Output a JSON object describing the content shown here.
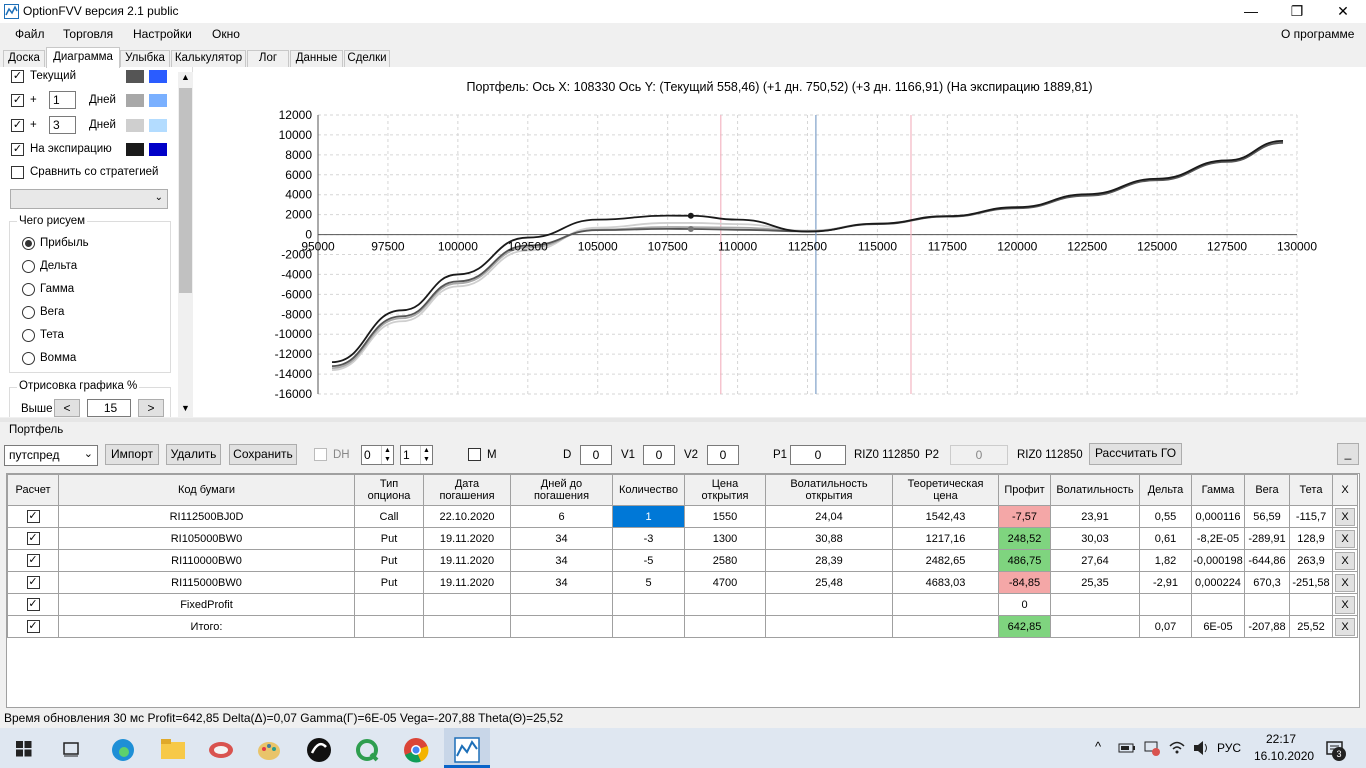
{
  "app": {
    "title": "OptionFVV версия 2.1 public"
  },
  "menu": {
    "items": [
      "Файл",
      "Торговля",
      "Настройки",
      "Окно"
    ],
    "about": "О программе"
  },
  "tabs": [
    {
      "label": "Доска"
    },
    {
      "label": "Диаграмма"
    },
    {
      "label": "Улыбка"
    },
    {
      "label": "Калькулятор"
    },
    {
      "label": "Лог"
    },
    {
      "label": "Данные"
    },
    {
      "label": "Сделки"
    }
  ],
  "left_panel": {
    "current_label": "Текущий",
    "plus_label": "+",
    "days_label": "Дней",
    "days1": "1",
    "days2": "3",
    "expiry_label": "На экспирацию",
    "compare_label": "Сравнить со стратегией",
    "what_title": "Чего рисуем",
    "radios": [
      "Прибыль",
      "Дельта",
      "Гамма",
      "Вега",
      "Тета",
      "Вомма"
    ],
    "draw_title": "Отрисовка графика %",
    "above_label": "Выше",
    "above_value": "15",
    "prev_btn": "<",
    "next_btn": ">",
    "colors": {
      "current": [
        "#555555",
        "#2a5cff"
      ],
      "day1": [
        "#a8a8a8",
        "#7ab0ff"
      ],
      "day3": [
        "#cfcfcf",
        "#b3dcff"
      ],
      "expiry": [
        "#1a1a1a",
        "#0000c8"
      ]
    }
  },
  "chart_header": "Портфель: Ось X: 108330 Ось Y:  (Текущий 558,46)  (+1 дн. 750,52)  (+3 дн. 1166,91)  (На экспирацию 1889,81)",
  "chart_data": {
    "type": "line",
    "xlim": [
      95000,
      130000
    ],
    "ylim": [
      -16000,
      12000
    ],
    "x_ticks": [
      "95000",
      "97500",
      "100000",
      "102500",
      "105000",
      "107500",
      "110000",
      "112500",
      "115000",
      "117500",
      "120000",
      "122500",
      "125000",
      "127500",
      "130000"
    ],
    "y_ticks": [
      "12000",
      "10000",
      "8000",
      "6000",
      "4000",
      "2000",
      "0",
      "-2000",
      "-4000",
      "-6000",
      "-8000",
      "-10000",
      "-12000",
      "-14000",
      "-16000"
    ],
    "vlines": [
      {
        "x": 109400,
        "color": "#f4b6c2"
      },
      {
        "x": 112800,
        "color": "#7fa0c8"
      },
      {
        "x": 116200,
        "color": "#f4b6c2"
      }
    ],
    "series": [
      {
        "color": "#1a1a1a",
        "x": [
          95500,
          98000,
          100000,
          102500,
          105000,
          107500,
          108330,
          110000,
          112500,
          115000,
          117500,
          120000,
          122500,
          125000,
          127500,
          129500
        ],
        "y": [
          -12800,
          -7600,
          -4000,
          -300,
          1500,
          1900,
          1890,
          1500,
          300,
          1100,
          1850,
          2750,
          4050,
          5600,
          7450,
          9400
        ]
      },
      {
        "color": "#555555",
        "x": [
          95500,
          98000,
          100000,
          102500,
          105000,
          107500,
          108330,
          110000,
          112500,
          115000,
          117500,
          120000,
          122500,
          125000,
          127500,
          129500
        ],
        "y": [
          -13200,
          -8200,
          -4700,
          -1100,
          450,
          570,
          558,
          480,
          320,
          1050,
          1800,
          2650,
          3900,
          5450,
          7300,
          9200
        ]
      },
      {
        "color": "#a8a8a8",
        "x": [
          95500,
          98000,
          100000,
          102500,
          105000,
          107500,
          108330,
          110000,
          112500,
          115000,
          117500,
          120000,
          122500,
          125000,
          127500,
          129500
        ],
        "y": [
          -13400,
          -8400,
          -4900,
          -1300,
          500,
          760,
          750,
          700,
          350,
          1080,
          1820,
          2680,
          3950,
          5500,
          7350,
          9250
        ]
      },
      {
        "color": "#cfcfcf",
        "x": [
          95500,
          98000,
          100000,
          102500,
          105000,
          107500,
          108330,
          110000,
          112500,
          115000,
          117500,
          120000,
          122500,
          125000,
          127500,
          129500
        ],
        "y": [
          -13600,
          -8700,
          -5200,
          -1600,
          700,
          1170,
          1167,
          1050,
          400,
          1090,
          1830,
          2700,
          3980,
          5530,
          7380,
          9300
        ]
      }
    ],
    "markers": [
      {
        "x": 108330,
        "y": 1890,
        "color": "#1a1a1a"
      },
      {
        "x": 108330,
        "y": 558,
        "color": "#777777"
      }
    ]
  },
  "portfolio": {
    "group_label": "Портфель",
    "strategy_select": "путспред",
    "import_btn": "Импорт",
    "delete_btn": "Удалить",
    "save_btn": "Сохранить",
    "dh_label": "DH",
    "spin1": "0",
    "spin2": "1",
    "m_label": "M",
    "d_label": "D",
    "d_value": "0",
    "v1_label": "V1",
    "v1_value": "0",
    "v2_label": "V2",
    "v2_value": "0",
    "p1_label": "P1",
    "p1_value": "0",
    "riz1": "RIZ0 112850",
    "p2_label": "P2",
    "p2_value": "0",
    "riz2": "RIZ0 112850",
    "calc_btn": "Рассчитать ГО",
    "min_btn": "_"
  },
  "table": {
    "headers": [
      "Расчет",
      "Код бумаги",
      "Тип\nопциона",
      "Дата\nпогашения",
      "Дней до\nпогашения",
      "Количество",
      "Цена\nоткрытия",
      "Волатильность\nоткрытия",
      "Теоретическая\nцена",
      "Профит",
      "Волатильность",
      "Дельта",
      "Гамма",
      "Вега",
      "Тета",
      "X"
    ],
    "rows": [
      [
        "RI112500BJ0D",
        "Call",
        "22.10.2020",
        "6",
        "1",
        "1550",
        "24,04",
        "1542,43",
        "-7,57",
        "23,91",
        "0,55",
        "0,000116",
        "56,59",
        "-115,7"
      ],
      [
        "RI105000BW0",
        "Put",
        "19.11.2020",
        "34",
        "-3",
        "1300",
        "30,88",
        "1217,16",
        "248,52",
        "30,03",
        "0,61",
        "-8,2E-05",
        "-289,91",
        "128,9"
      ],
      [
        "RI110000BW0",
        "Put",
        "19.11.2020",
        "34",
        "-5",
        "2580",
        "28,39",
        "2482,65",
        "486,75",
        "27,64",
        "1,82",
        "-0,000198",
        "-644,86",
        "263,9"
      ],
      [
        "RI115000BW0",
        "Put",
        "19.11.2020",
        "34",
        "5",
        "4700",
        "25,48",
        "4683,03",
        "-84,85",
        "25,35",
        "-2,91",
        "0,000224",
        "670,3",
        "-251,58"
      ],
      [
        "FixedProfit",
        "",
        "",
        "",
        "",
        "",
        "",
        "",
        "0",
        "",
        "",
        "",
        "",
        ""
      ],
      [
        "Итого:",
        "",
        "",
        "",
        "",
        "",
        "",
        "",
        "642,85",
        "",
        "0,07",
        "6E-05",
        "-207,88",
        "25,52"
      ]
    ],
    "x_label": "X",
    "check": "✓"
  },
  "status": "Время обновления 30 мс  Profit=642,85 Delta(Δ)=0,07 Gamma(Γ)=6E-05 Vega=-207,88 Theta(Θ)=25,52",
  "taskbar": {
    "lang": "РУС",
    "time": "22:17",
    "date": "16.10.2020",
    "notif": "3",
    "up_arrow": "^"
  }
}
